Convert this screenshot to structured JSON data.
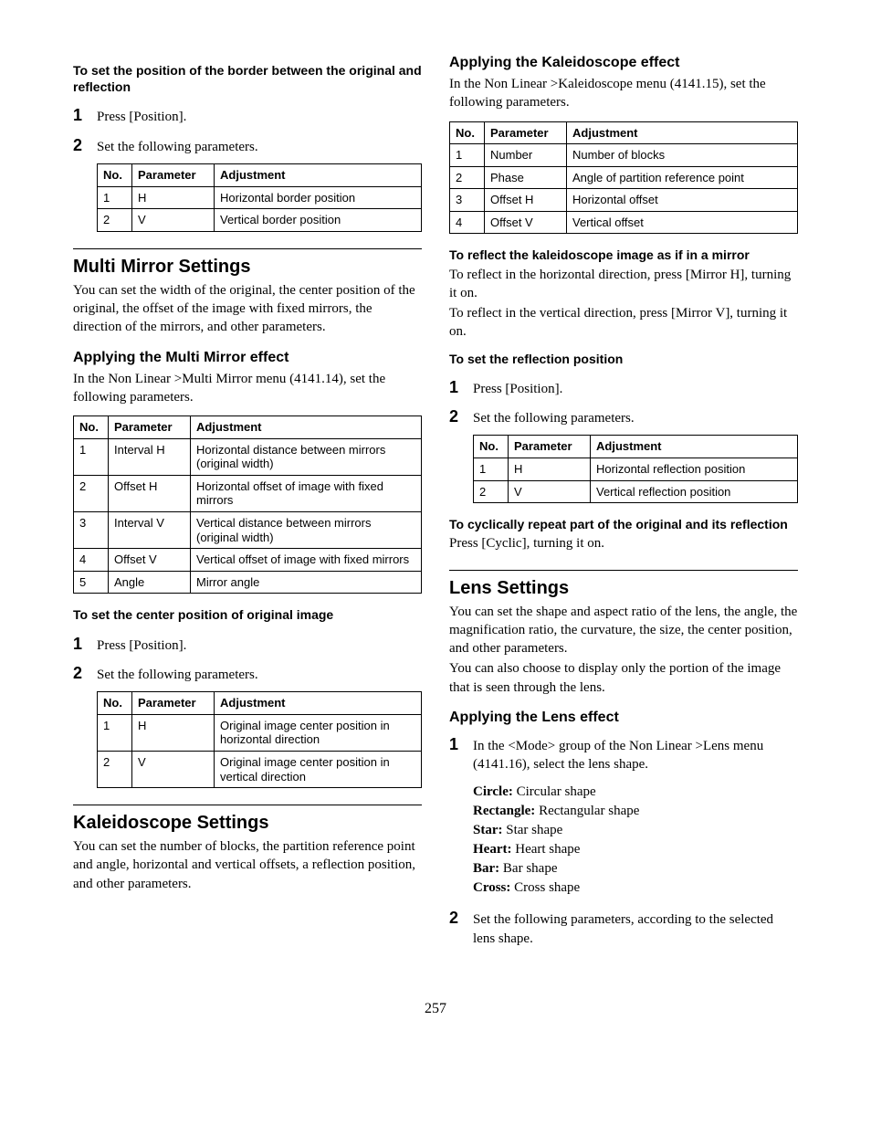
{
  "left": {
    "borderHeading": "To set the position of the border between the original and reflection",
    "step1": "Press [Position].",
    "step2": "Set the following parameters.",
    "borderTable": {
      "h": [
        "No.",
        "Parameter",
        "Adjustment"
      ],
      "r": [
        [
          "1",
          "H",
          "Horizontal border position"
        ],
        [
          "2",
          "V",
          "Vertical border position"
        ]
      ]
    },
    "multiMirrorTitle": "Multi Mirror Settings",
    "multiMirrorIntro": "You can set the width of the original, the center position of the original, the offset of the image with fixed mirrors, the direction of the mirrors, and other parameters.",
    "applyMultiTitle": "Applying the Multi Mirror effect",
    "applyMultiIntro": "In the Non Linear >Multi Mirror menu (4141.14), set the following parameters.",
    "multiTable": {
      "h": [
        "No.",
        "Parameter",
        "Adjustment"
      ],
      "r": [
        [
          "1",
          "Interval H",
          "Horizontal distance between mirrors (original width)"
        ],
        [
          "2",
          "Offset H",
          "Horizontal offset of image with fixed mirrors"
        ],
        [
          "3",
          "Interval V",
          "Vertical distance between mirrors (original width)"
        ],
        [
          "4",
          "Offset V",
          "Vertical offset of image with fixed mirrors"
        ],
        [
          "5",
          "Angle",
          "Mirror angle"
        ]
      ]
    },
    "centerHeading": "To set the center position of original image",
    "centerStep1": "Press [Position].",
    "centerStep2": "Set the following parameters.",
    "centerTable": {
      "h": [
        "No.",
        "Parameter",
        "Adjustment"
      ],
      "r": [
        [
          "1",
          "H",
          "Original image center position in horizontal direction"
        ],
        [
          "2",
          "V",
          "Original image center position in vertical direction"
        ]
      ]
    },
    "kaleidoTitle": "Kaleidoscope Settings",
    "kaleidoIntro": "You can set the number of blocks, the partition reference point and angle, horizontal and vertical offsets, a reflection position, and other parameters."
  },
  "right": {
    "applyKaleidoTitle": "Applying the Kaleidoscope effect",
    "applyKaleidoIntro": "In the Non Linear >Kaleidoscope menu (4141.15), set the following parameters.",
    "kaleidoTable": {
      "h": [
        "No.",
        "Parameter",
        "Adjustment"
      ],
      "r": [
        [
          "1",
          "Number",
          "Number of blocks"
        ],
        [
          "2",
          "Phase",
          "Angle of partition reference point"
        ],
        [
          "3",
          "Offset H",
          "Horizontal offset"
        ],
        [
          "4",
          "Offset V",
          "Vertical offset"
        ]
      ]
    },
    "reflectHeading": "To reflect the kaleidoscope image as if in a mirror",
    "reflectH": "To reflect in the horizontal direction, press [Mirror H], turning it on.",
    "reflectV": "To reflect in the vertical direction, press [Mirror V], turning it on.",
    "reflPosHeading": "To set the reflection position",
    "reflStep1": "Press [Position].",
    "reflStep2": "Set the following parameters.",
    "reflTable": {
      "h": [
        "No.",
        "Parameter",
        "Adjustment"
      ],
      "r": [
        [
          "1",
          "H",
          "Horizontal reflection position"
        ],
        [
          "2",
          "V",
          "Vertical reflection position"
        ]
      ]
    },
    "cyclicHeading": "To cyclically repeat part of the original and its reflection",
    "cyclicBody": "Press [Cyclic], turning it on.",
    "lensTitle": "Lens Settings",
    "lensIntro1": "You can set the shape and aspect ratio of the lens, the angle, the magnification ratio, the curvature, the size, the center position, and other parameters.",
    "lensIntro2": "You can also choose to display only the portion of the image that is seen through the lens.",
    "applyLensTitle": "Applying the Lens effect",
    "lensStep1": "In the <Mode> group of the Non Linear >Lens menu (4141.16), select the lens shape.",
    "shapes": {
      "circle": {
        "label": "Circle:",
        "desc": " Circular shape"
      },
      "rectangle": {
        "label": "Rectangle:",
        "desc": " Rectangular shape"
      },
      "star": {
        "label": "Star:",
        "desc": " Star shape"
      },
      "heart": {
        "label": "Heart:",
        "desc": " Heart shape"
      },
      "bar": {
        "label": "Bar:",
        "desc": " Bar shape"
      },
      "cross": {
        "label": "Cross:",
        "desc": " Cross shape"
      }
    },
    "lensStep2": "Set the following parameters, according to the selected lens shape."
  },
  "pageNumber": "257"
}
